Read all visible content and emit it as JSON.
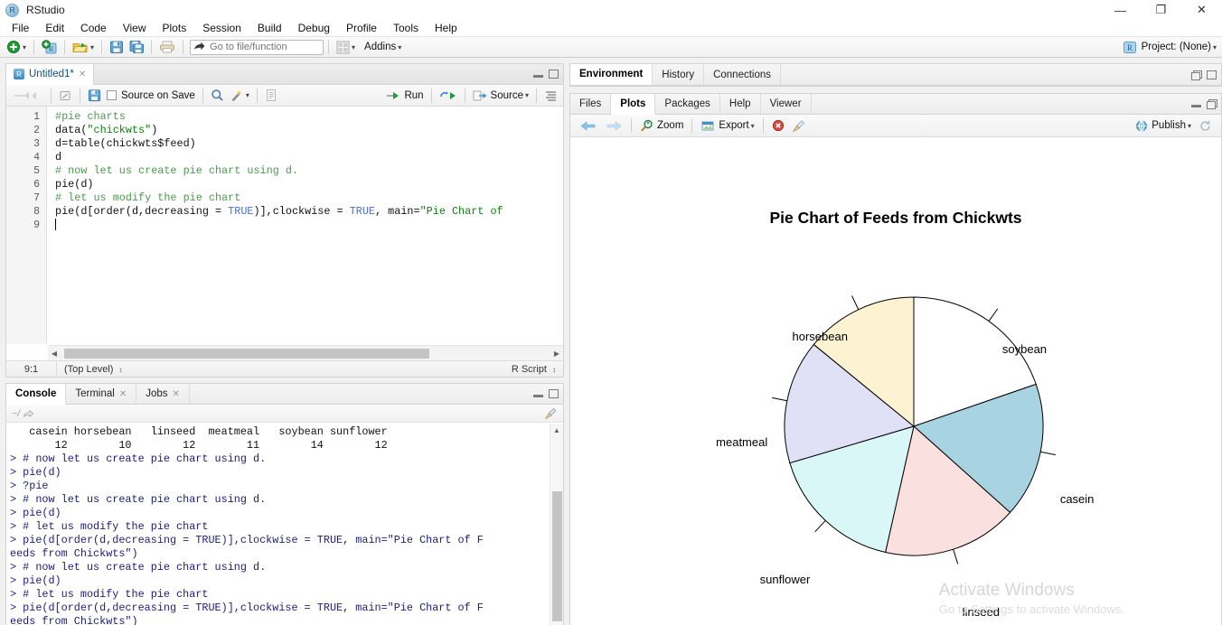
{
  "window": {
    "title": "RStudio",
    "minimize": "—",
    "restore": "❐",
    "close": "✕"
  },
  "menubar": {
    "items": [
      "File",
      "Edit",
      "Code",
      "View",
      "Plots",
      "Session",
      "Build",
      "Debug",
      "Profile",
      "Tools",
      "Help"
    ]
  },
  "toolbar": {
    "goto_placeholder": "Go to file/function",
    "goto_value": "",
    "addins_label": "Addins",
    "project_label": "Project: (None)"
  },
  "source": {
    "tab_label": "Untitled1*",
    "tab_close": "✕",
    "source_on_save_label": "Source on Save",
    "run_label": "Run",
    "source_label": "Source",
    "lines": [
      {
        "n": "1",
        "segments": [
          {
            "t": "#pie charts",
            "c": "c-com"
          }
        ]
      },
      {
        "n": "2",
        "segments": [
          {
            "t": "data(",
            "c": ""
          },
          {
            "t": "\"chickwts\"",
            "c": "c-str"
          },
          {
            "t": ")",
            "c": ""
          }
        ]
      },
      {
        "n": "3",
        "segments": [
          {
            "t": "d=table(chickwts$feed)",
            "c": ""
          }
        ]
      },
      {
        "n": "4",
        "segments": [
          {
            "t": "d",
            "c": ""
          }
        ]
      },
      {
        "n": "5",
        "segments": [
          {
            "t": "# now let us create pie chart using d.",
            "c": "c-com"
          }
        ]
      },
      {
        "n": "6",
        "segments": [
          {
            "t": "pie(d)",
            "c": ""
          }
        ]
      },
      {
        "n": "7",
        "segments": [
          {
            "t": "# let us modify the pie chart",
            "c": "c-com"
          }
        ]
      },
      {
        "n": "8",
        "segments": [
          {
            "t": "pie(d[order(d,decreasing = ",
            "c": ""
          },
          {
            "t": "TRUE",
            "c": "c-kw"
          },
          {
            "t": ")],clockwise = ",
            "c": ""
          },
          {
            "t": "TRUE",
            "c": "c-kw"
          },
          {
            "t": ", main=",
            "c": ""
          },
          {
            "t": "\"Pie Chart of",
            "c": "c-str"
          }
        ]
      },
      {
        "n": "9",
        "segments": []
      }
    ],
    "status": {
      "position": "9:1",
      "scope": "(Top Level)",
      "filetype": "R Script"
    }
  },
  "console": {
    "tabs": [
      {
        "label": "Console",
        "active": true,
        "closeable": false
      },
      {
        "label": "Terminal",
        "active": false,
        "closeable": true
      },
      {
        "label": "Jobs",
        "active": false,
        "closeable": true
      }
    ],
    "tab_close": "✕",
    "working_dir": "~/",
    "lines": [
      {
        "t": "   casein horsebean   linseed  meatmeal   soybean sunflower",
        "k": "out"
      },
      {
        "t": "       12        10        12        11        14        12",
        "k": "out"
      },
      {
        "t": "> # now let us create pie chart using d.",
        "k": "in"
      },
      {
        "t": "> pie(d)",
        "k": "in"
      },
      {
        "t": "> ?pie",
        "k": "in"
      },
      {
        "t": "> # now let us create pie chart using d.",
        "k": "in"
      },
      {
        "t": "> pie(d)",
        "k": "in"
      },
      {
        "t": "> # let us modify the pie chart",
        "k": "in"
      },
      {
        "t": "> pie(d[order(d,decreasing = TRUE)],clockwise = TRUE, main=\"Pie Chart of F",
        "k": "in"
      },
      {
        "t": "eeds from Chickwts\")",
        "k": "in"
      },
      {
        "t": "> # now let us create pie chart using d.",
        "k": "in"
      },
      {
        "t": "> pie(d)",
        "k": "in"
      },
      {
        "t": "> # let us modify the pie chart",
        "k": "in"
      },
      {
        "t": "> pie(d[order(d,decreasing = TRUE)],clockwise = TRUE, main=\"Pie Chart of F",
        "k": "in"
      },
      {
        "t": "eeds from Chickwts\")",
        "k": "in"
      }
    ]
  },
  "env_panel": {
    "tabs": [
      "Environment",
      "History",
      "Connections"
    ]
  },
  "plot_panel": {
    "tabs": [
      {
        "label": "Files",
        "active": false
      },
      {
        "label": "Plots",
        "active": true
      },
      {
        "label": "Packages",
        "active": false
      },
      {
        "label": "Help",
        "active": false
      },
      {
        "label": "Viewer",
        "active": false
      }
    ],
    "toolbar": {
      "back_label": "",
      "forward_label": "",
      "zoom_label": "Zoom",
      "export_label": "Export",
      "remove_label": "",
      "clear_label": "",
      "publish_label": "Publish",
      "refresh_label": ""
    }
  },
  "watermark": {
    "line1": "Activate Windows",
    "line2": "Go to Settings to activate Windows."
  },
  "chart_data": {
    "type": "pie",
    "title": "Pie Chart of Feeds from Chickwts",
    "labels": [
      "soybean",
      "casein",
      "linseed",
      "sunflower",
      "meatmeal",
      "horsebean"
    ],
    "values": [
      14,
      12,
      12,
      12,
      11,
      10
    ],
    "colors": [
      "#ffffff",
      "#a8d3e0",
      "#fbe0e0",
      "#d9f7f7",
      "#e0e0f7",
      "#fdf3d2"
    ],
    "total": 71,
    "clockwise": true,
    "start_angle_deg": 90,
    "border_color": "#000000",
    "legend": "none",
    "label_placement": "outside-with-leader-lines",
    "source_table": {
      "columns": [
        "casein",
        "horsebean",
        "linseed",
        "meatmeal",
        "soybean",
        "sunflower"
      ],
      "counts": [
        12,
        10,
        12,
        11,
        14,
        12
      ]
    }
  }
}
